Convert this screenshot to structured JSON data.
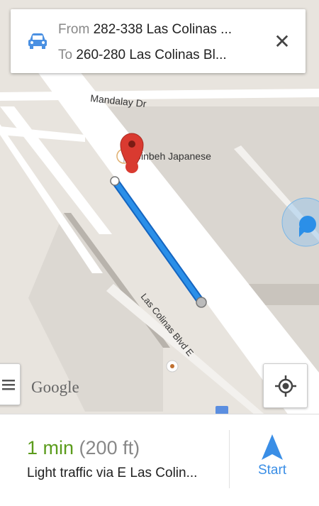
{
  "route": {
    "from_prefix": "From",
    "from_address": "282-338 Las Colinas ...",
    "to_prefix": "To",
    "to_address": "260-280 Las Colinas Bl...",
    "close_label": "✕"
  },
  "map": {
    "street_top": "Mandalay Dr",
    "street_main": "Las Colinas Blvd E",
    "place_name": "Jinbeh Japanese",
    "attribution": "Google"
  },
  "summary": {
    "duration": "1 min",
    "distance": "(200 ft)",
    "traffic": "Light traffic via E Las Colin...",
    "start_label": "Start"
  },
  "colors": {
    "route_blue": "#2b8fe8",
    "eta_green": "#5b9c1c",
    "pin_red": "#d93a30",
    "start_blue": "#3a8ee6"
  },
  "icons": {
    "mode": "car-icon",
    "close": "close-icon",
    "locate": "my-location-icon",
    "menu": "menu-icon",
    "start": "navigation-arrow-icon",
    "destination": "map-pin-icon",
    "restaurant": "restaurant-icon"
  }
}
